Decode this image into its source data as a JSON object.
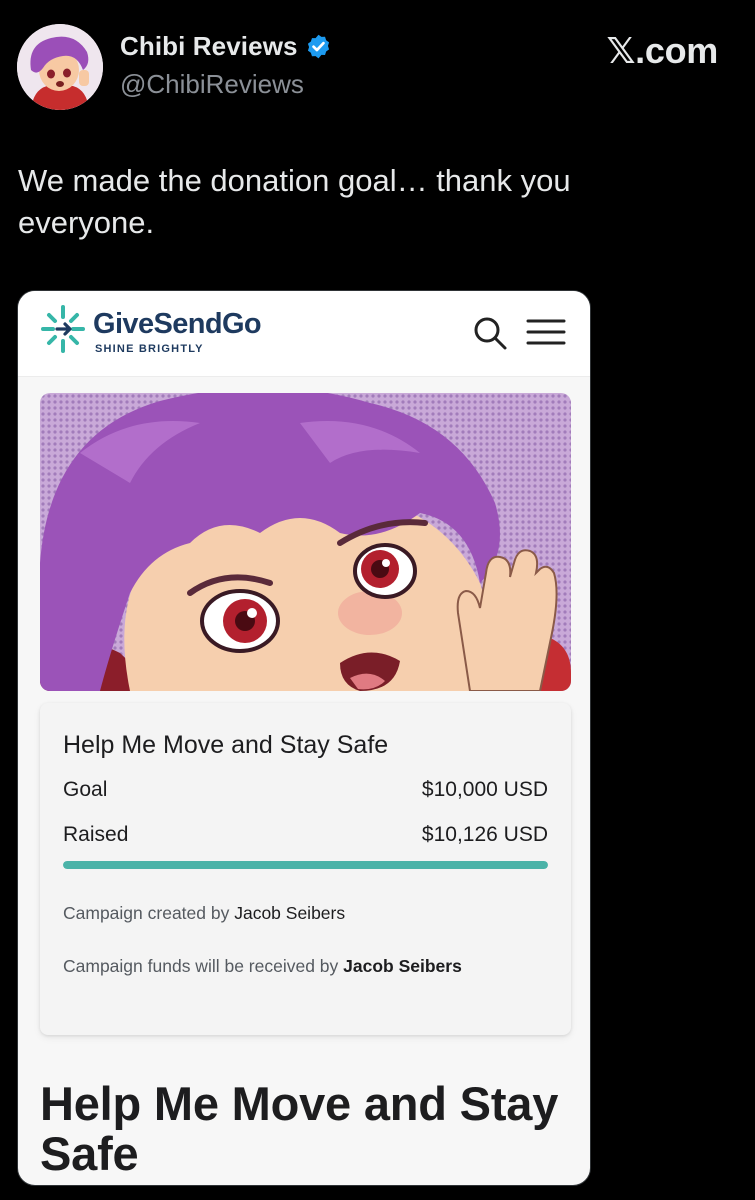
{
  "tweet": {
    "display_name": "Chibi Reviews",
    "handle": "@ChibiReviews",
    "site": "𝕏.com",
    "text": "We made the donation goal… thank you everyone.",
    "verified_color": "#1d9bf0"
  },
  "embed": {
    "brand": {
      "name": "GiveSendGo",
      "tagline": "SHINE BRIGHTLY",
      "color": "#1e3a5f",
      "accent": "#36b6a8"
    },
    "icons": {
      "search": "search-icon",
      "menu": "hamburger-menu-icon"
    },
    "campaign": {
      "title": "Help Me Move and Stay Safe",
      "goal_label": "Goal",
      "goal_value": "$10,000 USD",
      "raised_label": "Raised",
      "raised_value": "$10,126 USD",
      "progress_fraction": 1.0,
      "created_by_prefix": "Campaign created by ",
      "created_by_name": "Jacob Seibers",
      "funds_prefix": "Campaign funds will be received by ",
      "funds_name": "Jacob Seibers",
      "progress_color": "#4bb3a8"
    },
    "heading": "Help Me Move and Stay Safe"
  }
}
